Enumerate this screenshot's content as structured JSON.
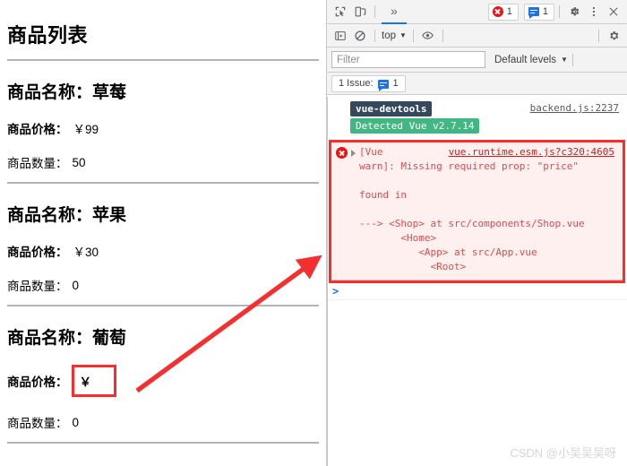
{
  "page": {
    "title": "商品列表",
    "labels": {
      "name": "商品名称：",
      "price": "商品价格：",
      "qty": "商品数量：",
      "currency": "￥"
    },
    "products": [
      {
        "name": "草莓",
        "price": "￥99",
        "price_value": "99",
        "qty": "50",
        "price_missing": false
      },
      {
        "name": "苹果",
        "price": "￥30",
        "price_value": "30",
        "qty": "0",
        "price_missing": false
      },
      {
        "name": "葡萄",
        "price": "￥",
        "price_value": "",
        "qty": "0",
        "price_missing": true
      }
    ]
  },
  "devtools": {
    "toolbar": {
      "inspect_icon": "inspect-element-icon",
      "device_icon": "device-toolbar-icon",
      "overflow_tab_label": "»",
      "error_count": "1",
      "message_count": "1",
      "settings_icon": "gear-icon",
      "more_icon": "kebab-menu-icon",
      "close_icon": "close-icon"
    },
    "console_toolbar": {
      "sidebar_icon": "console-sidebar-icon",
      "clear_icon": "clear-console-icon",
      "context": "top",
      "eye_icon": "live-expression-eye-icon",
      "settings_icon": "gear-icon"
    },
    "filterbar": {
      "filter_placeholder": "Filter",
      "filter_value": "",
      "levels_label": "Default levels"
    },
    "issuesbar": {
      "label": "1 Issue:",
      "count": "1"
    },
    "messages": {
      "vue_devtools_badge": "vue-devtools",
      "vue_detected_badge": "Detected Vue v2.7.14",
      "vue_source": "backend.js:2237",
      "error_source": "vue.runtime.esm.js?c320:4605",
      "error_text": "[Vue\nwarn]: Missing required prop: \"price\"\n\nfound in\n\n---> <Shop> at src/components/Shop.vue\n       <Home>\n          <App> at src/App.vue\n            <Root>"
    },
    "prompt_caret": ">"
  },
  "watermark": "CSDN @小吴吴吴呀",
  "colors": {
    "annotation_red": "#fb2c2c",
    "error_red": "#dd4b4b",
    "error_bg": "#fff0f0",
    "vue_dark": "#35495e",
    "vue_green": "#41b883",
    "accent_blue": "#1a73e8"
  }
}
